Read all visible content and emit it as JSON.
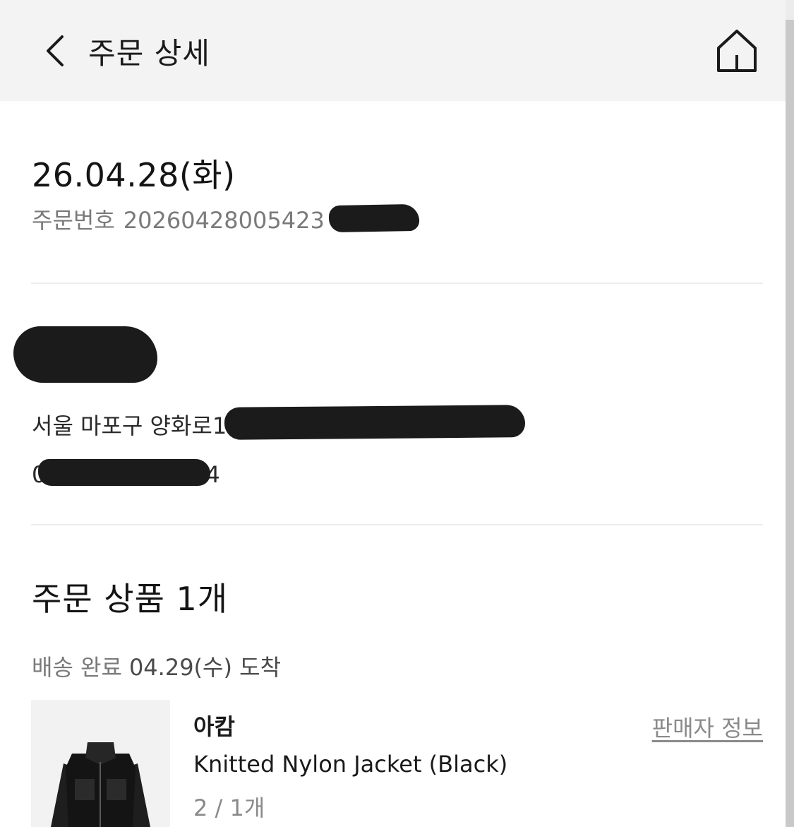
{
  "header": {
    "title": "주문 상세",
    "back_icon": "chevron-left-icon",
    "home_icon": "home-icon"
  },
  "order": {
    "date": "26.04.28(화)",
    "number_label": "주문번호",
    "number_visible": "20260428005423"
  },
  "shipping": {
    "address_visible": "서울 마포구 양화로1",
    "phone_visible_start": "0",
    "phone_visible_end": "4"
  },
  "products_section": {
    "title": "주문 상품 1개",
    "delivery_status": "배송 완료",
    "arrival": "04.29(수) 도착"
  },
  "product": {
    "brand": "아캄",
    "seller_info_label": "판매자 정보",
    "name": "Knitted Nylon Jacket (Black)",
    "option": "2 / 1개"
  },
  "colors": {
    "header_bg": "#f3f3f3",
    "text_primary": "#141414",
    "text_secondary": "#7a7a7a",
    "divider": "#ededed",
    "redaction": "#1b1b1b"
  }
}
